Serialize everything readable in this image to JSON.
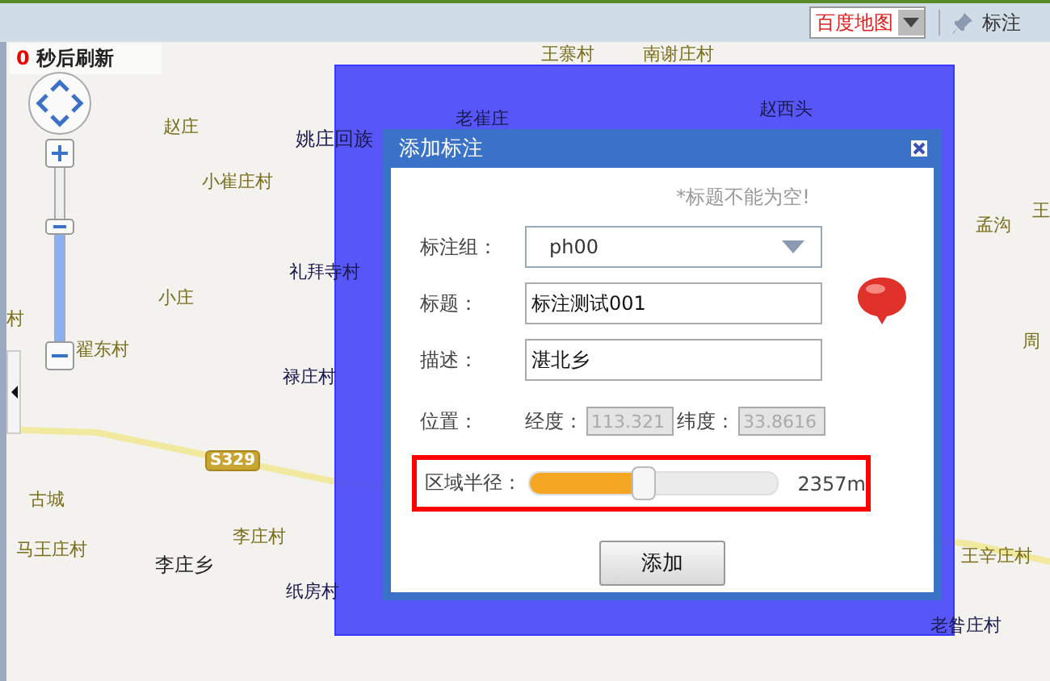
{
  "toolbar": {
    "map_type": "百度地图",
    "mark_button": "标注"
  },
  "refresh": {
    "count": "0",
    "text": "秒后刷新"
  },
  "road_badge": "S329",
  "zoom": {
    "level": 0.65
  },
  "map_labels": [
    {
      "text": "王寨村",
      "kind": "village"
    },
    {
      "text": "南谢庄村",
      "kind": "village"
    },
    {
      "text": "老崔庄",
      "kind": "village"
    },
    {
      "text": "赵西头",
      "kind": "village"
    },
    {
      "text": "赵庄",
      "kind": "village"
    },
    {
      "text": "姚庄回族",
      "kind": "town"
    },
    {
      "text": "小崔庄村",
      "kind": "village"
    },
    {
      "text": "礼拜寺村",
      "kind": "village"
    },
    {
      "text": "小庄",
      "kind": "village"
    },
    {
      "text": "村",
      "kind": "village"
    },
    {
      "text": "翟东村",
      "kind": "village"
    },
    {
      "text": "禄庄村",
      "kind": "village"
    },
    {
      "text": "古城",
      "kind": "village"
    },
    {
      "text": "马王庄村",
      "kind": "village"
    },
    {
      "text": "李庄乡",
      "kind": "town"
    },
    {
      "text": "李庄村",
      "kind": "village"
    },
    {
      "text": "纸房村",
      "kind": "village"
    },
    {
      "text": "孟沟",
      "kind": "village"
    },
    {
      "text": "王",
      "kind": "village"
    },
    {
      "text": "周",
      "kind": "village"
    },
    {
      "text": "王辛庄村",
      "kind": "village"
    },
    {
      "text": "老昝庄村",
      "kind": "village"
    }
  ],
  "dialog": {
    "title": "添加标注",
    "error": "*标题不能为空!",
    "fields": [
      {
        "kind": "select",
        "label": "标注组：",
        "value": "ph00"
      },
      {
        "kind": "text",
        "label": "标题：",
        "value": "标注测试001"
      },
      {
        "kind": "text",
        "label": "描述：",
        "value": "湛北乡"
      }
    ],
    "position": {
      "label": "位置：",
      "longitude_label": "经度：",
      "longitude": "113.321",
      "latitude_label": "纬度：",
      "latitude": "33.8616"
    },
    "radius": {
      "label": "区域半径：",
      "level": 0.46,
      "reading": "2357m"
    },
    "submit": "添加"
  }
}
